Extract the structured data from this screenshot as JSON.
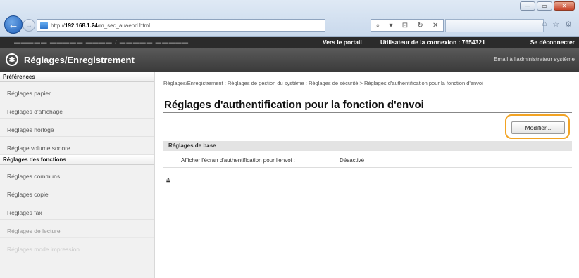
{
  "browser": {
    "url_prefix": "http://",
    "url_host": "192.168.1.24",
    "url_path": "/m_sec_auaend.html",
    "address_controls": [
      "⌕",
      "▾",
      "⊡",
      "↻",
      "✕"
    ],
    "window_buttons": [
      "—",
      "▭",
      "✕"
    ]
  },
  "topbar": {
    "device_name": "▬▬▬▬▬ ▬▬▬▬▬ ▬▬▬▬ / ▬▬▬▬▬ ▬▬▬▬▬",
    "portal_link": "Vers le portail",
    "user_label": "Utilisateur de la connexion :  7654321",
    "logout_link": "Se déconnecter"
  },
  "header": {
    "title": "Réglages/Enregistrement",
    "email_admin": "Email à l'administrateur système"
  },
  "sidebar": {
    "section1": "Préférences",
    "items1": [
      "Réglages papier",
      "Réglages d'affichage",
      "Réglages horloge",
      "Réglage volume sonore"
    ],
    "section2": "Réglages des fonctions",
    "items2": [
      "Réglages communs",
      "Réglages copie",
      "Réglages fax",
      "Réglages de lecture",
      "Réglages mode impression"
    ]
  },
  "main": {
    "breadcrumb": "Réglages/Enregistrement : Réglages de gestion du système : Réglages de sécurité > Réglages d'authentification pour la fonction d'envoi",
    "page_title": "Réglages d'authentification pour la fonction d'envoi",
    "modify_button": "Modifier...",
    "section_header": "Réglages de base",
    "setting_label": "Afficher l'écran d'authentification pour l'envoi :",
    "setting_value": "Désactivé",
    "top_link": "⩮"
  },
  "colors": {
    "highlight": "#f2a323",
    "header_bg": "#3a3a3a",
    "topbar_bg": "#2b2b2b"
  }
}
